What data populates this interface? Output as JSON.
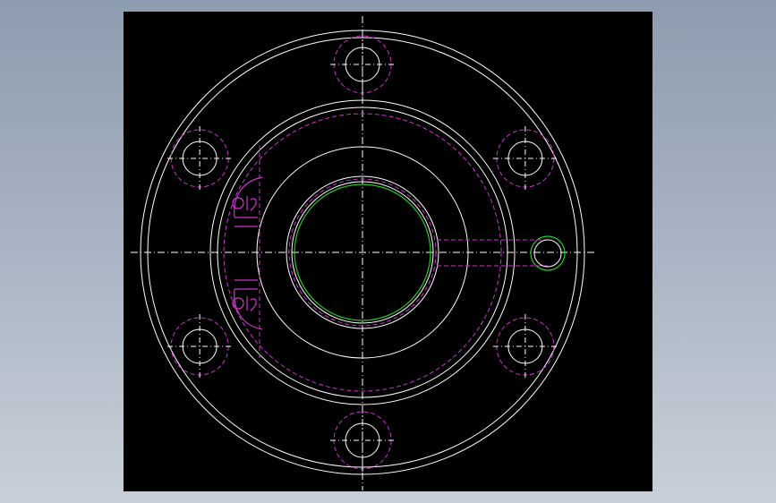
{
  "colors": {
    "background": "#8e9caf",
    "canvas": "#000000",
    "outline": "#ffffff",
    "hidden_line": "#cc33cc",
    "centerline": "#ffffff",
    "highlight": "#22cc22"
  },
  "drawing": {
    "view": "flange-front-view",
    "bolt_hole_count": 6,
    "has_side_port": true,
    "section_marks": [
      "front-hidden-body",
      "side-port"
    ]
  }
}
